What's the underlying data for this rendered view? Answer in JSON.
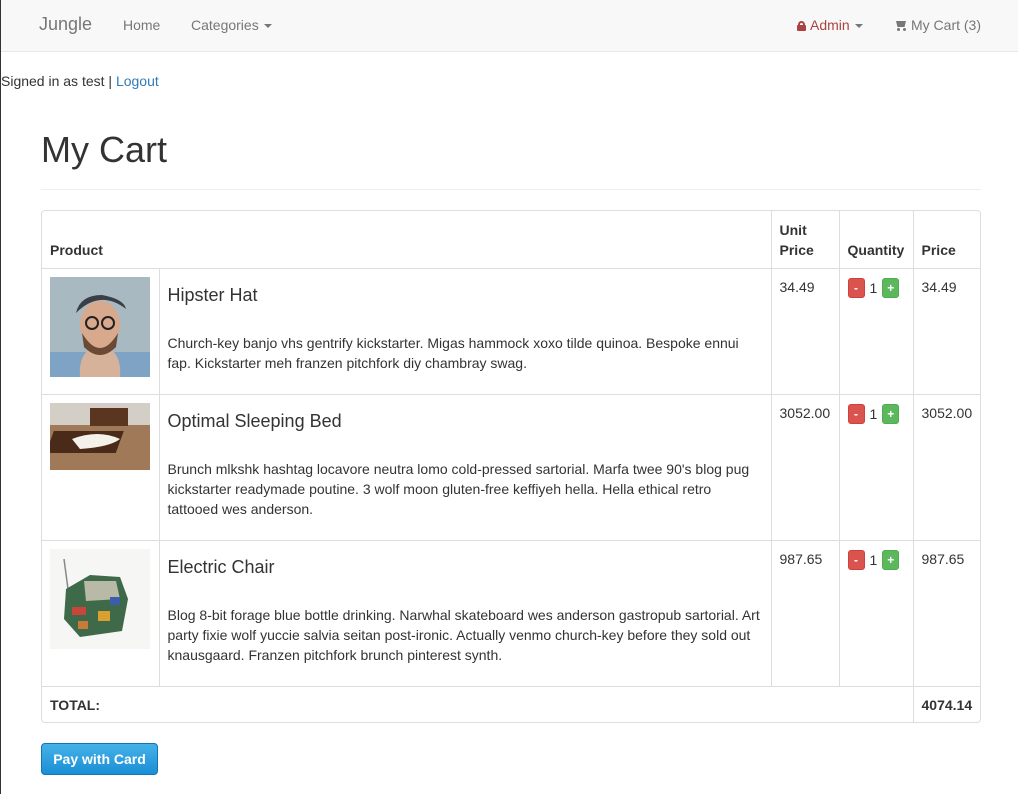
{
  "navbar": {
    "brand": "Jungle",
    "home": "Home",
    "categories": "Categories",
    "admin": "Admin",
    "cart": "My Cart (3)"
  },
  "session": {
    "signed_in_text": "Signed in as test |",
    "logout": "Logout"
  },
  "page": {
    "title": "My Cart"
  },
  "table": {
    "headers": {
      "product": "Product",
      "unit_price": "Unit Price",
      "quantity": "Quantity",
      "price": "Price"
    },
    "minus_label": "-",
    "plus_label": "+",
    "rows": [
      {
        "name": "Hipster Hat",
        "description": "Church-key banjo vhs gentrify kickstarter. Migas hammock xoxo tilde quinoa. Bespoke ennui fap. Kickstarter meh franzen pitchfork diy chambray swag.",
        "unit_price": "34.49",
        "quantity": "1",
        "price": "34.49"
      },
      {
        "name": "Optimal Sleeping Bed",
        "description": "Brunch mlkshk hashtag locavore neutra lomo cold-pressed sartorial. Marfa twee 90's blog pug kickstarter readymade poutine. 3 wolf moon gluten-free keffiyeh hella. Hella ethical retro tattooed wes anderson.",
        "unit_price": "3052.00",
        "quantity": "1",
        "price": "3052.00"
      },
      {
        "name": "Electric Chair",
        "description": "Blog 8-bit forage blue bottle drinking. Narwhal skateboard wes anderson gastropub sartorial. Art party fixie wolf yuccie salvia seitan post-ironic. Actually venmo church-key before they sold out knausgaard. Franzen pitchfork brunch pinterest synth.",
        "unit_price": "987.65",
        "quantity": "1",
        "price": "987.65"
      }
    ],
    "total_label": "TOTAL:",
    "total_value": "4074.14"
  },
  "checkout": {
    "pay_button": "Pay with Card"
  },
  "colors": {
    "danger": "#d9534f",
    "success": "#5cb85c",
    "link": "#337ab7",
    "admin": "#a94442",
    "pay_button": "#1a8fd6"
  }
}
